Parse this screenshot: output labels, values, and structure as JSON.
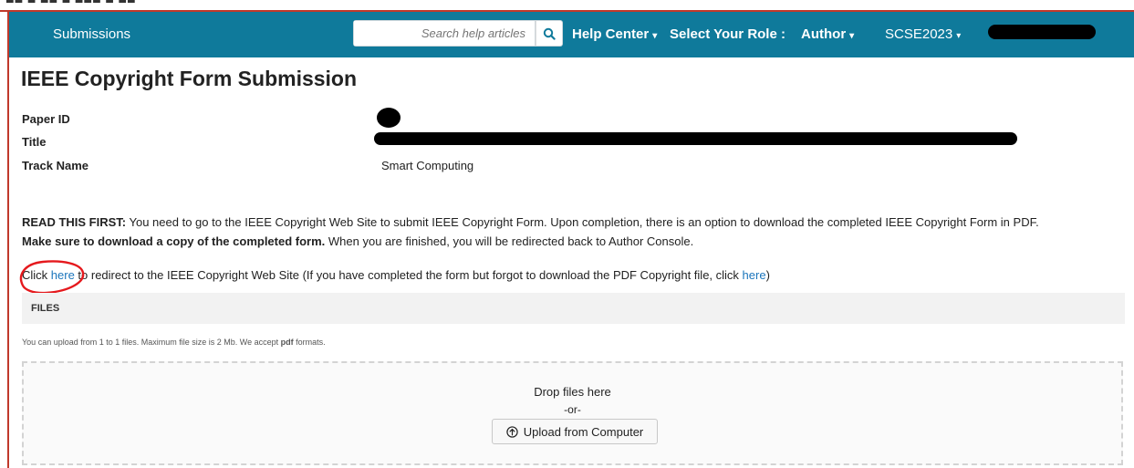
{
  "topbar": {
    "brand": "Submissions",
    "search_placeholder": "Search help articles",
    "help_center": "Help Center",
    "select_role_label": "Select Your Role :",
    "role": "Author",
    "conference": "SCSE2023",
    "colors": {
      "navbar": "#0f7a9b"
    }
  },
  "page": {
    "title": "IEEE Copyright Form Submission",
    "fields": [
      {
        "label": "Paper ID",
        "value": ""
      },
      {
        "label": "Title",
        "value": ""
      },
      {
        "label": "Track Name",
        "value": "Smart Computing"
      }
    ]
  },
  "notice": {
    "bold_lead": "READ THIS FIRST:",
    "text1": " You need to go to the IEEE Copyright Web Site to submit IEEE Copyright Form. Upon completion, there is an option to download the completed IEEE Copyright Form in PDF.",
    "bold2": "Make sure to download a copy of the completed form.",
    "text2": " When you are finished, you will be redirected back to Author Console."
  },
  "redirect": {
    "prefix": "Click ",
    "link1": "here",
    "middle": " to redirect to the IEEE Copyright Web Site (If you have completed the form but forgot to download the PDF Copyright file, click ",
    "link2": "here",
    "suffix": ")"
  },
  "files": {
    "header": "FILES",
    "note_prefix": "You can upload from 1 to 1 files. Maximum file size is 2 Mb. We accept ",
    "note_format": "pdf",
    "note_suffix": " formats.",
    "drop_text": "Drop files here",
    "or_text": "-or-",
    "upload_button": "Upload from Computer"
  }
}
